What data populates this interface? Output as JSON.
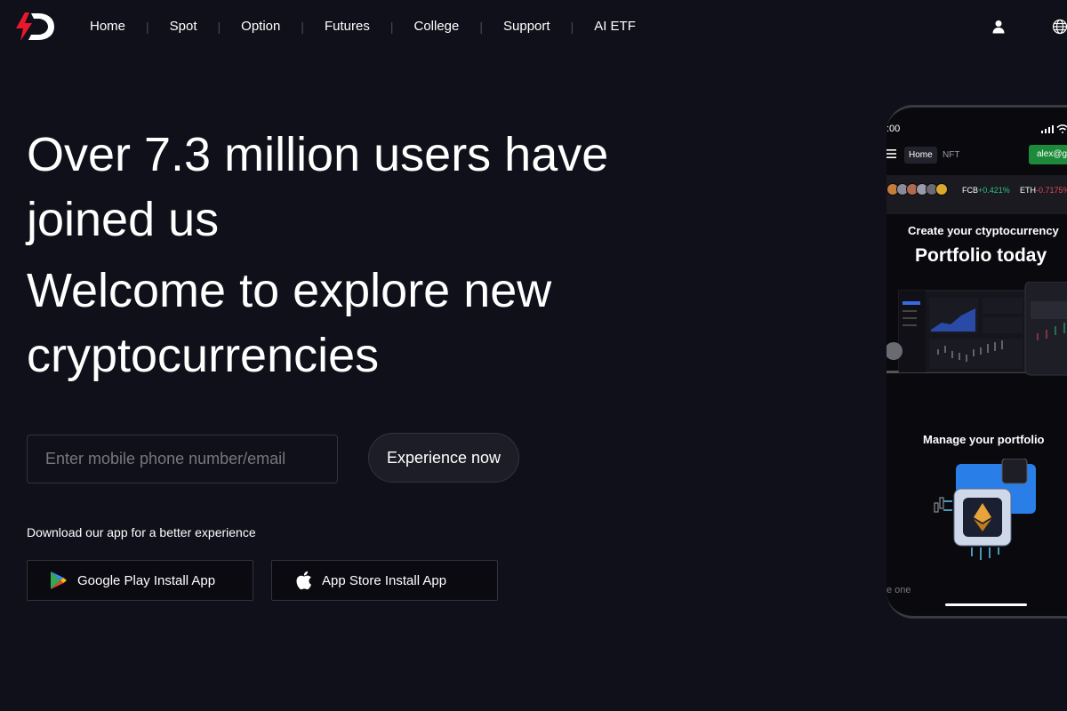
{
  "nav": {
    "links": [
      "Home",
      "Spot",
      "Option",
      "Futures",
      "College",
      "Support",
      "AI ETF"
    ],
    "separator": "|",
    "icons": {
      "logo": "4d-logo",
      "user": "user-icon",
      "language": "globe-icon"
    },
    "logo_colors": {
      "red": "#e8192c",
      "white": "#ffffff"
    }
  },
  "hero": {
    "line1": "Over 7.3 million users have joined us",
    "line2": "Welcome to explore new cryptocurrencies"
  },
  "signup": {
    "placeholder": "Enter mobile phone number/email",
    "cta_label": "Experience now"
  },
  "download": {
    "text": "Download our app for a better experience",
    "google_play_label": "Google Play Install App",
    "app_store_label": "App Store Install App"
  },
  "phone": {
    "time": ":00",
    "nav_home": "Home",
    "nav_nft": "NFT",
    "email": "alex@gr",
    "ticker": [
      {
        "symbol": "FCB",
        "change": "+0.421%"
      },
      {
        "symbol": "ETH",
        "change": "-0.7175%"
      }
    ],
    "headline_small": "Create your ctyptocurrency",
    "headline_large": "Portfolio today",
    "manage_title": "Manage your portfolio",
    "footer_text": "e one"
  },
  "colors": {
    "background": "#10101a",
    "ticker_up": "#2ec27e",
    "ticker_down": "#e64a5a",
    "email_button": "#1c8a3a"
  }
}
